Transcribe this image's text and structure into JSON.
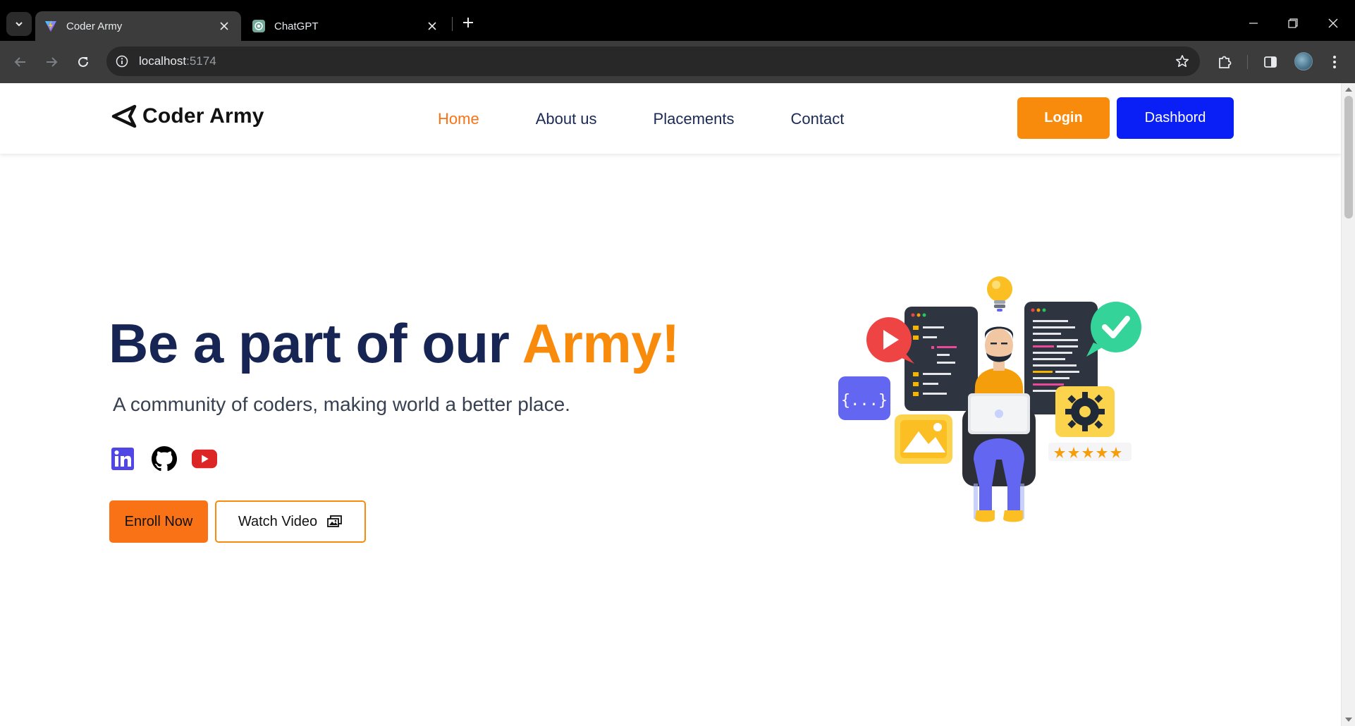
{
  "browser": {
    "tabs": [
      {
        "title": "Coder Army",
        "active": true,
        "favicon": "vite-icon"
      },
      {
        "title": "ChatGPT",
        "active": false,
        "favicon": "chatgpt-icon"
      }
    ],
    "url_host": "localhost",
    "url_port": ":5174"
  },
  "site": {
    "logo_text": "Coder Army",
    "nav": [
      {
        "label": "Home",
        "active": true
      },
      {
        "label": "About us",
        "active": false
      },
      {
        "label": "Placements",
        "active": false
      },
      {
        "label": "Contact",
        "active": false
      }
    ],
    "login_label": "Login",
    "dashboard_label": "Dashbord"
  },
  "hero": {
    "title_main": "Be a part of our ",
    "title_accent": "Army!",
    "subtitle": "A community of coders, making world a better place.",
    "socials": [
      "linkedin-icon",
      "github-icon",
      "youtube-icon"
    ],
    "enroll_label": "Enroll Now",
    "watch_label": "Watch Video",
    "illustration_code_text": "{...}",
    "rating_stars": 5
  },
  "colors": {
    "accent_orange": "#f98b0c",
    "dashboard_blue": "#0a1ff5",
    "title_navy": "#172554"
  }
}
